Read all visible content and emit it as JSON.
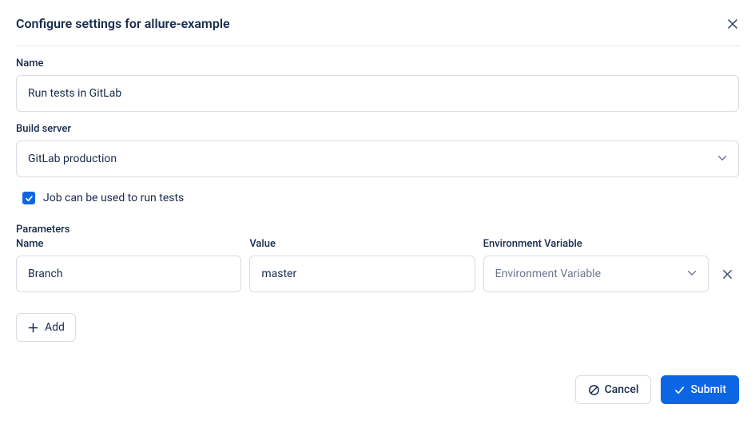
{
  "title": "Configure settings for allure-example",
  "fields": {
    "name": {
      "label": "Name",
      "value": "Run tests in GitLab"
    },
    "build_server": {
      "label": "Build server",
      "value": "GitLab production"
    },
    "job_checkbox": {
      "label": "Job can be used to run tests",
      "checked": true
    }
  },
  "parameters": {
    "title": "Parameters",
    "columns": {
      "name": "Name",
      "value": "Value",
      "env": "Environment Variable"
    },
    "rows": [
      {
        "name": "Branch",
        "value": "master",
        "env_placeholder": "Environment Variable"
      }
    ],
    "add_label": "Add"
  },
  "footer": {
    "cancel": "Cancel",
    "submit": "Submit"
  }
}
